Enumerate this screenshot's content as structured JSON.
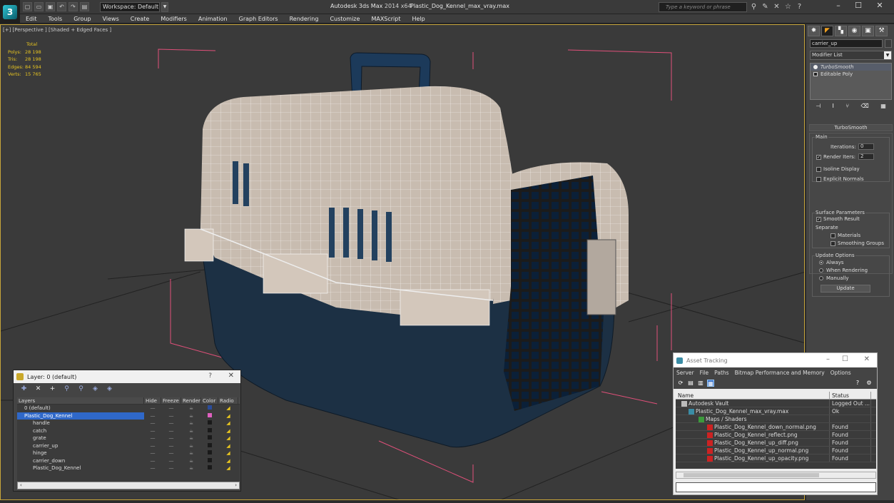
{
  "titlebar": {
    "workspace": "Workspace: Default",
    "app_title": "Autodesk 3ds Max",
    "app_version": "2014 x64",
    "file_name": "Plastic_Dog_Kennel_max_vray.max",
    "search_placeholder": "Type a keyword or phrase"
  },
  "menu": [
    "Edit",
    "Tools",
    "Group",
    "Views",
    "Create",
    "Modifiers",
    "Animation",
    "Graph Editors",
    "Rendering",
    "Customize",
    "MAXScript",
    "Help"
  ],
  "viewport": {
    "label": "[+] [Perspective ] [Shaded + Edged Faces ]",
    "stats": {
      "header": "Total",
      "polys_label": "Polys:",
      "polys": "28 198",
      "tris_label": "Tris:",
      "tris": "28 198",
      "edges_label": "Edges:",
      "edges": "84 594",
      "verts_label": "Verts:",
      "verts": "15 765"
    }
  },
  "command_panel": {
    "object_name": "carrier_up",
    "modifier_list": "Modifier List",
    "stack": [
      "TurboSmooth",
      "Editable Poly"
    ],
    "rollout_title": "TurboSmooth",
    "main_group": "Main",
    "iterations_label": "Iterations:",
    "iterations": "0",
    "render_iters_label": "Render Iters:",
    "render_iters": "2",
    "isoline": "Isoline Display",
    "explicit_normals": "Explicit Normals",
    "surface_group": "Surface Parameters",
    "smooth_result": "Smooth Result",
    "separate": "Separate",
    "materials": "Materials",
    "smoothing_groups": "Smoothing Groups",
    "update_group": "Update Options",
    "always": "Always",
    "when_rendering": "When Rendering",
    "manually": "Manually",
    "update_btn": "Update"
  },
  "layer_window": {
    "title": "Layer: 0 (default)",
    "columns": [
      "Layers",
      "Hide",
      "Freeze",
      "Render",
      "Color",
      "Radio"
    ],
    "rows": [
      {
        "name": "0 (default)",
        "color": "#2a4c9a"
      },
      {
        "name": "Plastic_Dog_Kennel",
        "color": "#e060c0"
      },
      {
        "name": "handle",
        "color": "#1a1a1a"
      },
      {
        "name": "catch",
        "color": "#1a1a1a"
      },
      {
        "name": "grate",
        "color": "#1a1a1a"
      },
      {
        "name": "carrier_up",
        "color": "#1a1a1a"
      },
      {
        "name": "hinge",
        "color": "#1a1a1a"
      },
      {
        "name": "carrier_down",
        "color": "#1a1a1a"
      },
      {
        "name": "Plastic_Dog_Kennel",
        "color": "#1a1a1a"
      }
    ]
  },
  "asset_window": {
    "title": "Asset Tracking",
    "menu": [
      "Server",
      "File",
      "Paths",
      "Bitmap Performance and Memory",
      "Options"
    ],
    "columns": [
      "Name",
      "Status"
    ],
    "rows": [
      {
        "name": "Autodesk Vault",
        "status": "Logged Out ..."
      },
      {
        "name": "Plastic_Dog_Kennel_max_vray.max",
        "status": "Ok"
      },
      {
        "name": "Maps / Shaders",
        "status": ""
      },
      {
        "name": "Plastic_Dog_Kennel_down_normal.png",
        "status": "Found"
      },
      {
        "name": "Plastic_Dog_Kennel_reflect.png",
        "status": "Found"
      },
      {
        "name": "Plastic_Dog_Kennel_up_diff.png",
        "status": "Found"
      },
      {
        "name": "Plastic_Dog_Kennel_up_normal.png",
        "status": "Found"
      },
      {
        "name": "Plastic_Dog_Kennel_up_opacity.png",
        "status": "Found"
      }
    ]
  }
}
